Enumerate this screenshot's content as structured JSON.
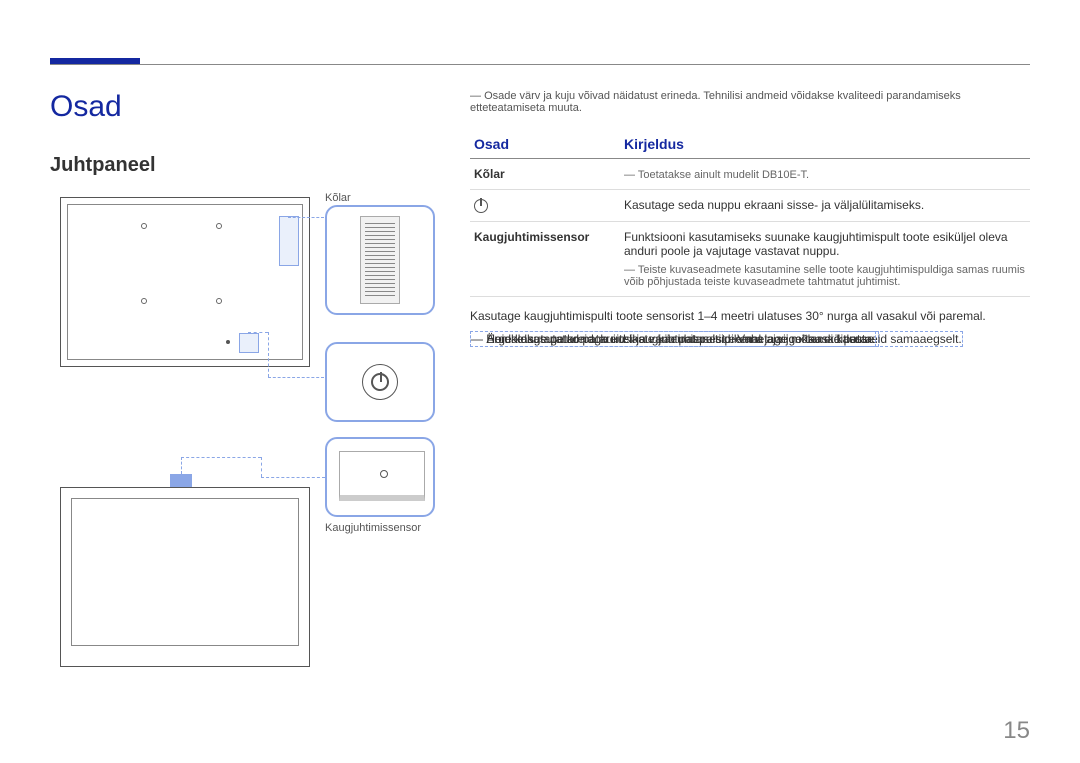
{
  "header": {
    "section_title": "Osad",
    "subsection_title": "Juhtpaneel"
  },
  "diagram_labels": {
    "speaker": "Kõlar",
    "remote_sensor": "Kaugjuhtimissensor"
  },
  "intro_note": "Osade värv ja kuju võivad näidatust erineda. Tehnilisi andmeid võidakse kvaliteedi parandamiseks etteteatamiseta muuta.",
  "table": {
    "col_part": "Osad",
    "col_desc": "Kirjeldus",
    "rows": [
      {
        "part": "Kõlar",
        "desc": "Toetatakse ainult mudelit DB10E-T.",
        "desc_is_note": true
      },
      {
        "part_icon": "power-icon",
        "desc": "Kasutage seda nuppu ekraani sisse- ja väljalülitamiseks."
      },
      {
        "part": "Kaugjuhtimissensor",
        "desc": "Funktsiooni kasutamiseks suunake kaugjuhtimispult toote esiküljel oleva anduri poole ja vajutage vastavat nuppu.",
        "sub": "Teiste kuvaseadmete kasutamine selle toote kaugjuhtimispuldiga samas ruumis võib põhjustada teiste kuvaseadmete tahtmatut juhtimist."
      }
    ]
  },
  "footer_lines": {
    "main": "Kasutage kaugjuhtimispulti toote sensorist 1–4 meetri ulatuses 30° nurga all vasakul või paremal.",
    "notes": [
      "Hoidke kasutatud patareid laste käeulatusest eemal ja viige taaskäitlusse.",
      "Ärge kasutage korraga uusi ja vanu patareisid. Vahetage mõlemad patareid samaaegselt.",
      "Eemaldage patareid, kui te kaugjuhtimispulti pikema aja jooksu ei kasuta."
    ]
  },
  "page_number": "15"
}
